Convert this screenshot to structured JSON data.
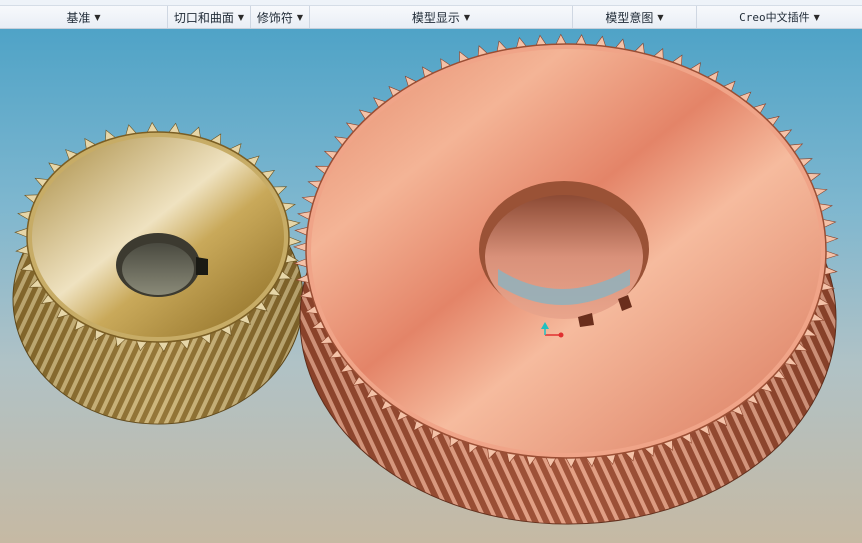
{
  "ribbon": {
    "groups": [
      {
        "label": "基准",
        "arrow": "▼"
      },
      {
        "label": "切口和曲面",
        "arrow": "▼"
      },
      {
        "label": "修饰符",
        "arrow": "▼"
      },
      {
        "label": "模型显示",
        "arrow": "▼"
      },
      {
        "label": "模型意图",
        "arrow": "▼"
      },
      {
        "label": "Creo中文插件",
        "arrow": "▼"
      }
    ]
  },
  "viewport": {
    "background_top": "#4fa3c7",
    "background_bottom": "#c6b9a3",
    "small_gear_color": "#c7a85a",
    "large_gear_color": "#e8957a",
    "axis_colors": {
      "x": "#e03030",
      "y": "#20c0c0"
    }
  }
}
